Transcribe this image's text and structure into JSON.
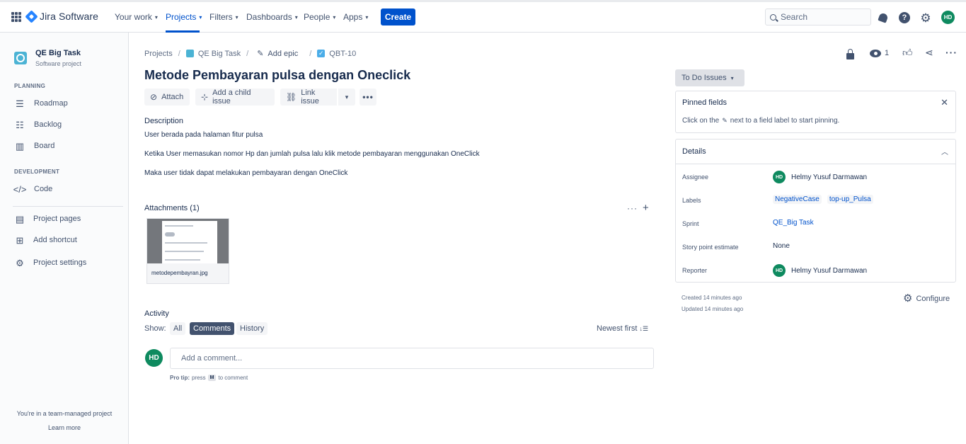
{
  "topnav": {
    "app_name": "Jira Software",
    "items": [
      {
        "label": "Your work"
      },
      {
        "label": "Projects"
      },
      {
        "label": "Filters"
      },
      {
        "label": "Dashboards"
      },
      {
        "label": "People"
      },
      {
        "label": "Apps"
      }
    ],
    "create_label": "Create",
    "search_placeholder": "Search",
    "avatar_initials": "HD"
  },
  "sidebar": {
    "project_name": "QE Big Task",
    "project_type": "Software project",
    "planning_heading": "PLANNING",
    "planning_items": [
      {
        "label": "Roadmap"
      },
      {
        "label": "Backlog"
      },
      {
        "label": "Board"
      }
    ],
    "development_heading": "DEVELOPMENT",
    "development_items": [
      {
        "label": "Code"
      }
    ],
    "other_items": [
      {
        "label": "Project pages"
      },
      {
        "label": "Add shortcut"
      },
      {
        "label": "Project settings"
      }
    ],
    "team_note": "You're in a team-managed project",
    "learn_more": "Learn more"
  },
  "breadcrumb": {
    "projects": "Projects",
    "project": "QE Big Task",
    "add_epic": "Add epic",
    "issue_key": "QBT-10"
  },
  "issue": {
    "title": "Metode Pembayaran pulsa dengan Oneclick",
    "actions": {
      "attach": "Attach",
      "add_child": "Add a child issue",
      "link_issue": "Link issue"
    },
    "description_label": "Description",
    "description_lines": [
      "User berada pada halaman fitur pulsa",
      "Ketika User memasukan nomor Hp dan jumlah pulsa lalu klik metode pembayaran menggunakan OneClick",
      "Maka user tidak dapat melakukan pembayaran dengan OneClick"
    ],
    "attachments_label": "Attachments (1)",
    "attachment_filename": "metodepembayran.jpg"
  },
  "activity": {
    "label": "Activity",
    "show_label": "Show:",
    "filters": {
      "all": "All",
      "comments": "Comments",
      "history": "History"
    },
    "sort_label": "Newest first",
    "comment_avatar": "HD",
    "comment_placeholder": "Add a comment...",
    "pro_tip_bold": "Pro tip:",
    "pro_tip_press": "press",
    "pro_tip_key": "M",
    "pro_tip_rest": "to comment"
  },
  "right_panel": {
    "watch_count": "1",
    "status_label": "To Do Issues",
    "pinned_title": "Pinned fields",
    "pinned_hint_before": "Click on the",
    "pinned_hint_after": "next to a field label to start pinning.",
    "details_title": "Details",
    "fields": {
      "assignee_label": "Assignee",
      "assignee_initials": "HD",
      "assignee_value": "Helmy Yusuf Darmawan",
      "labels_label": "Labels",
      "labels": [
        "NegativeCase",
        "top-up_Pulsa"
      ],
      "sprint_label": "Sprint",
      "sprint_value": "QE_Big Task",
      "story_points_label": "Story point estimate",
      "story_points_value": "None",
      "reporter_label": "Reporter",
      "reporter_initials": "HD",
      "reporter_value": "Helmy Yusuf Darmawan"
    },
    "created": "Created 14 minutes ago",
    "updated": "Updated 14 minutes ago",
    "configure_label": "Configure"
  },
  "colors": {
    "primary": "#0052cc",
    "avatar_green": "#0e8a5f",
    "text": "#172b4d",
    "subtle": "#42526e"
  }
}
